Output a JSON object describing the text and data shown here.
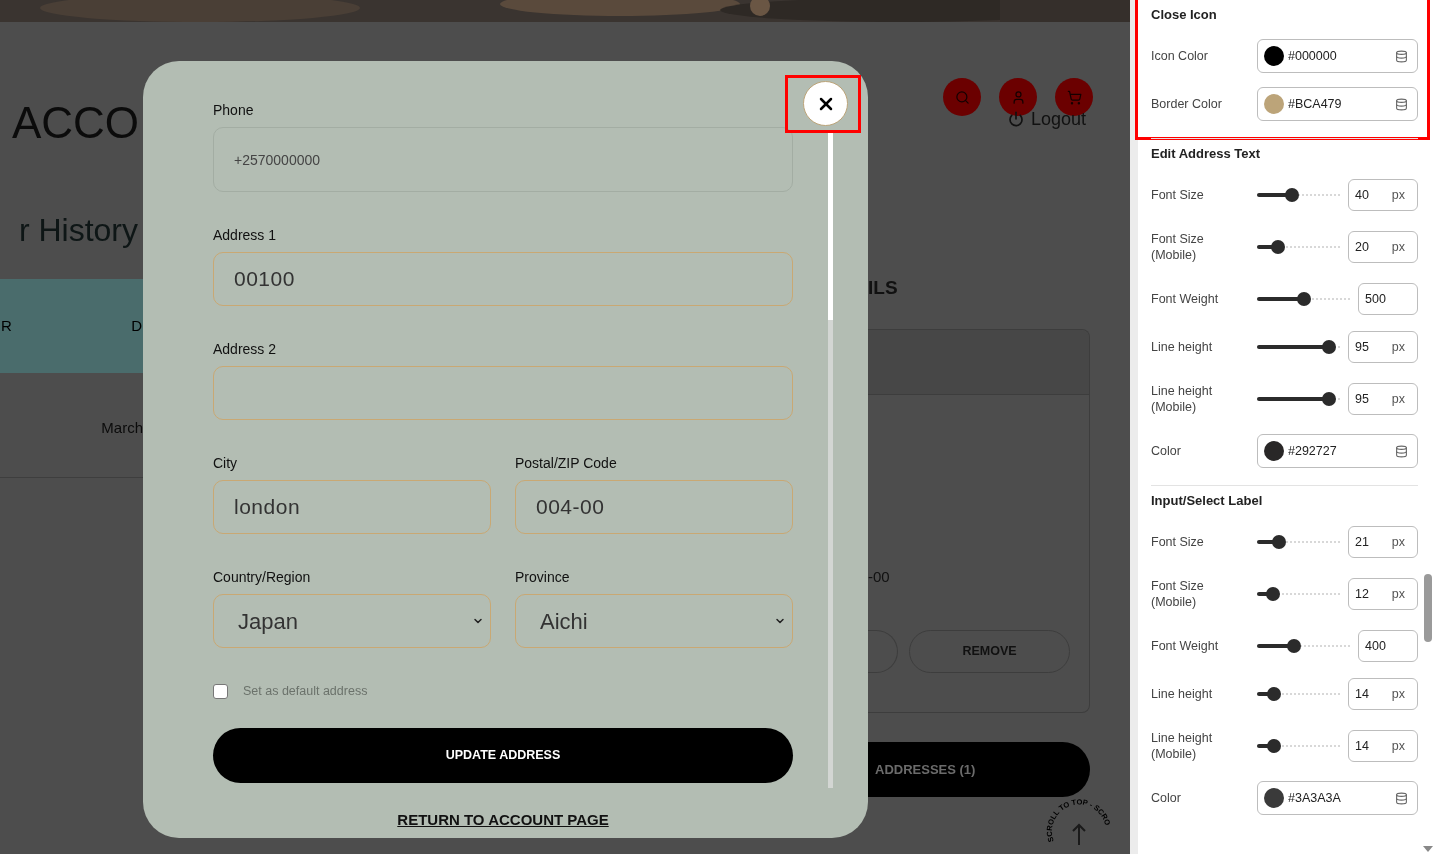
{
  "preview": {
    "logo_text": "ACCO",
    "page_heading": "r History",
    "table_header": [
      "R",
      "D"
    ],
    "table_row": [
      "March"
    ],
    "section_heading": "ILS",
    "logout": "Logout",
    "address_card": {
      "text": "-00",
      "buttons": [
        "REMOVE"
      ]
    },
    "addresses_button": "ADDRESSES (1)",
    "scroll_badge": "SCROLL TO TOP - SCRO"
  },
  "modal": {
    "close_button": {
      "highlighted": true
    },
    "rows": [
      [
        {
          "kind": "phone",
          "label": "Phone",
          "placeholder": "+2570000000"
        }
      ],
      [
        {
          "kind": "input",
          "label": "Address 1",
          "value": "00100"
        }
      ],
      [
        {
          "kind": "input",
          "label": "Address 2"
        }
      ],
      [
        {
          "kind": "input",
          "label": "City",
          "value": "london"
        },
        {
          "kind": "input",
          "label": "Postal/ZIP Code",
          "value": "004-00"
        }
      ],
      [
        {
          "kind": "select",
          "label": "Country/Region",
          "value": "Japan"
        },
        {
          "kind": "select",
          "label": "Province",
          "value": "Aichi"
        }
      ]
    ],
    "default_checkbox": {
      "label": "Set as default address",
      "checked": false
    },
    "submit_button": "UPDATE ADDRESS",
    "return_link": "RETURN TO ACCOUNT PAGE"
  },
  "settings": {
    "sections": [
      {
        "title": "Close Icon",
        "highlighted": true,
        "rows": [
          {
            "kind": "color",
            "label": "Icon Color",
            "value": "#000000",
            "color": "#000000"
          },
          {
            "kind": "color",
            "label": "Border Color",
            "value": "#BCA479",
            "color": "#bca479"
          }
        ]
      },
      {
        "title": "Edit Address Text",
        "highlighted": false,
        "rows": [
          {
            "kind": "slider",
            "label": "Font Size",
            "value": "40",
            "unit": "px",
            "level": 0.42
          },
          {
            "kind": "slider",
            "label": "Font Size (Mobile)",
            "value": "20",
            "unit": "px",
            "level": 0.25
          },
          {
            "kind": "slider",
            "label": "Font Weight",
            "value": "500",
            "level": 0.5
          },
          {
            "kind": "slider",
            "label": "Line height",
            "value": "95",
            "unit": "px",
            "level": 0.87
          },
          {
            "kind": "slider",
            "label": "Line height (Mobile)",
            "value": "95",
            "unit": "px",
            "level": 0.87
          },
          {
            "kind": "color",
            "label": "Color",
            "value": "#292727",
            "color": "#292727"
          }
        ]
      },
      {
        "title": "Input/Select Label",
        "highlighted": false,
        "rows": [
          {
            "kind": "slider",
            "label": "Font Size",
            "value": "21",
            "unit": "px",
            "level": 0.26
          },
          {
            "kind": "slider",
            "label": "Font Size (Mobile)",
            "value": "12",
            "unit": "px",
            "level": 0.19
          },
          {
            "kind": "slider",
            "label": "Font Weight",
            "value": "400",
            "level": 0.4
          },
          {
            "kind": "slider",
            "label": "Line height",
            "value": "14",
            "unit": "px",
            "level": 0.2
          },
          {
            "kind": "slider",
            "label": "Line height (Mobile)",
            "value": "14",
            "unit": "px",
            "level": 0.2
          },
          {
            "kind": "color",
            "label": "Color",
            "value": "#3A3A3A",
            "color": "#3a3a3a"
          }
        ]
      }
    ]
  }
}
